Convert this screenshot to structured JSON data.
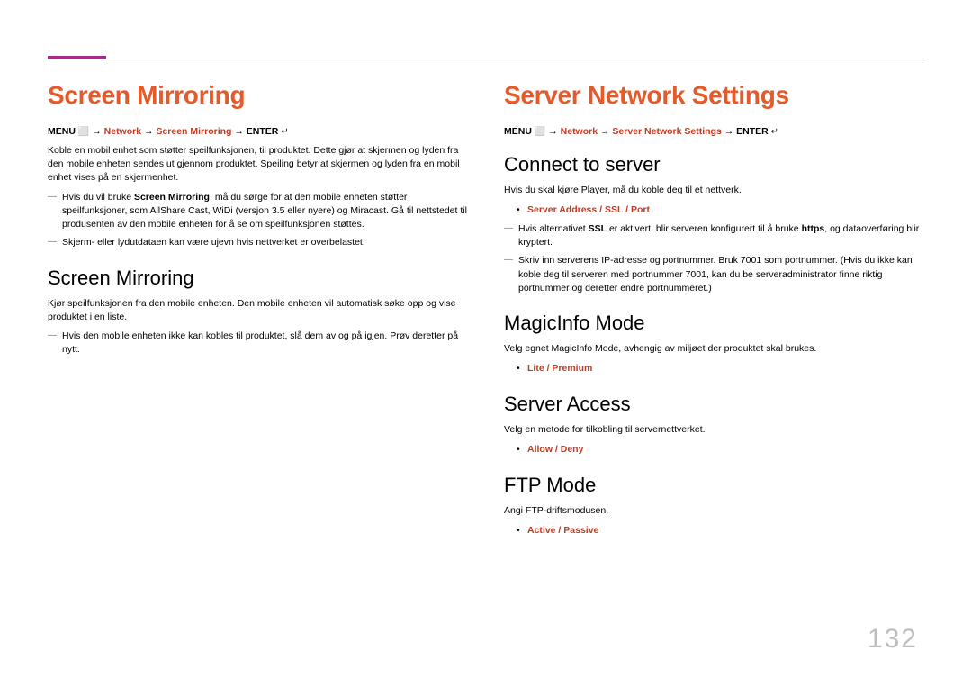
{
  "pageNumber": "132",
  "left": {
    "title": "Screen Mirroring",
    "menu": {
      "prefix": "MENU ",
      "icon1": "⬜",
      "arrow": " → ",
      "g1": "Network",
      "g2": "Screen Mirroring",
      "enter": "ENTER ",
      "icon2": "↵"
    },
    "intro": "Koble en mobil enhet som støtter speilfunksjonen, til produktet. Dette gjør at skjermen og lyden fra den mobile enheten sendes ut gjennom produktet. Speiling betyr at skjermen og lyden fra en mobil enhet vises på en skjermenhet.",
    "note1a": "Hvis du vil bruke ",
    "note1b": "Screen Mirroring",
    "note1c": ", må du sørge for at den mobile enheten støtter speilfunksjoner, som AllShare Cast, WiDi (versjon 3.5 eller nyere) og Miracast. Gå til nettstedet til produsenten av den mobile enheten for å se om speilfunksjonen støttes.",
    "note2": "Skjerm- eller lydutdataen kan være ujevn hvis nettverket er overbelastet.",
    "sub1": "Screen Mirroring",
    "sub1_body": "Kjør speilfunksjonen fra den mobile enheten. Den mobile enheten vil automatisk søke opp og vise produktet i en liste.",
    "sub1_note": "Hvis den mobile enheten ikke kan kobles til produktet, slå dem av og på igjen. Prøv deretter på nytt."
  },
  "right": {
    "title": "Server Network Settings",
    "menu": {
      "prefix": "MENU ",
      "icon1": "⬜",
      "arrow": " → ",
      "g1": "Network",
      "g2": "Server Network Settings",
      "enter": "ENTER ",
      "icon2": "↵"
    },
    "s1": "Connect to server",
    "s1_body_a": "Hvis du skal kjøre ",
    "s1_body_b": "Player",
    "s1_body_c": ", må du koble deg til et nettverk.",
    "s1_bullet": "Server Address / SSL / Port",
    "s1_note1a": "Hvis alternativet ",
    "s1_note1b": "SSL",
    "s1_note1c": " er aktivert, blir serveren konfigurert til å bruke ",
    "s1_note1d": "https",
    "s1_note1e": ", og dataoverføring blir kryptert.",
    "s1_note2": "Skriv inn serverens IP-adresse og portnummer. Bruk 7001 som portnummer. (Hvis du ikke kan koble deg til serveren med portnummer 7001, kan du be serveradministrator finne riktig portnummer og deretter endre portnummeret.)",
    "s2": "MagicInfo Mode",
    "s2_body_a": "Velg egnet ",
    "s2_body_b": "MagicInfo Mode",
    "s2_body_c": ", avhengig av miljøet der produktet skal brukes.",
    "s2_bullet": "Lite / Premium",
    "s3": "Server Access",
    "s3_body": "Velg en metode for tilkobling til servernettverket.",
    "s3_bullet": "Allow / Deny",
    "s4": "FTP Mode",
    "s4_body": "Angi FTP-driftsmodusen.",
    "s4_bullet": "Active / Passive"
  }
}
